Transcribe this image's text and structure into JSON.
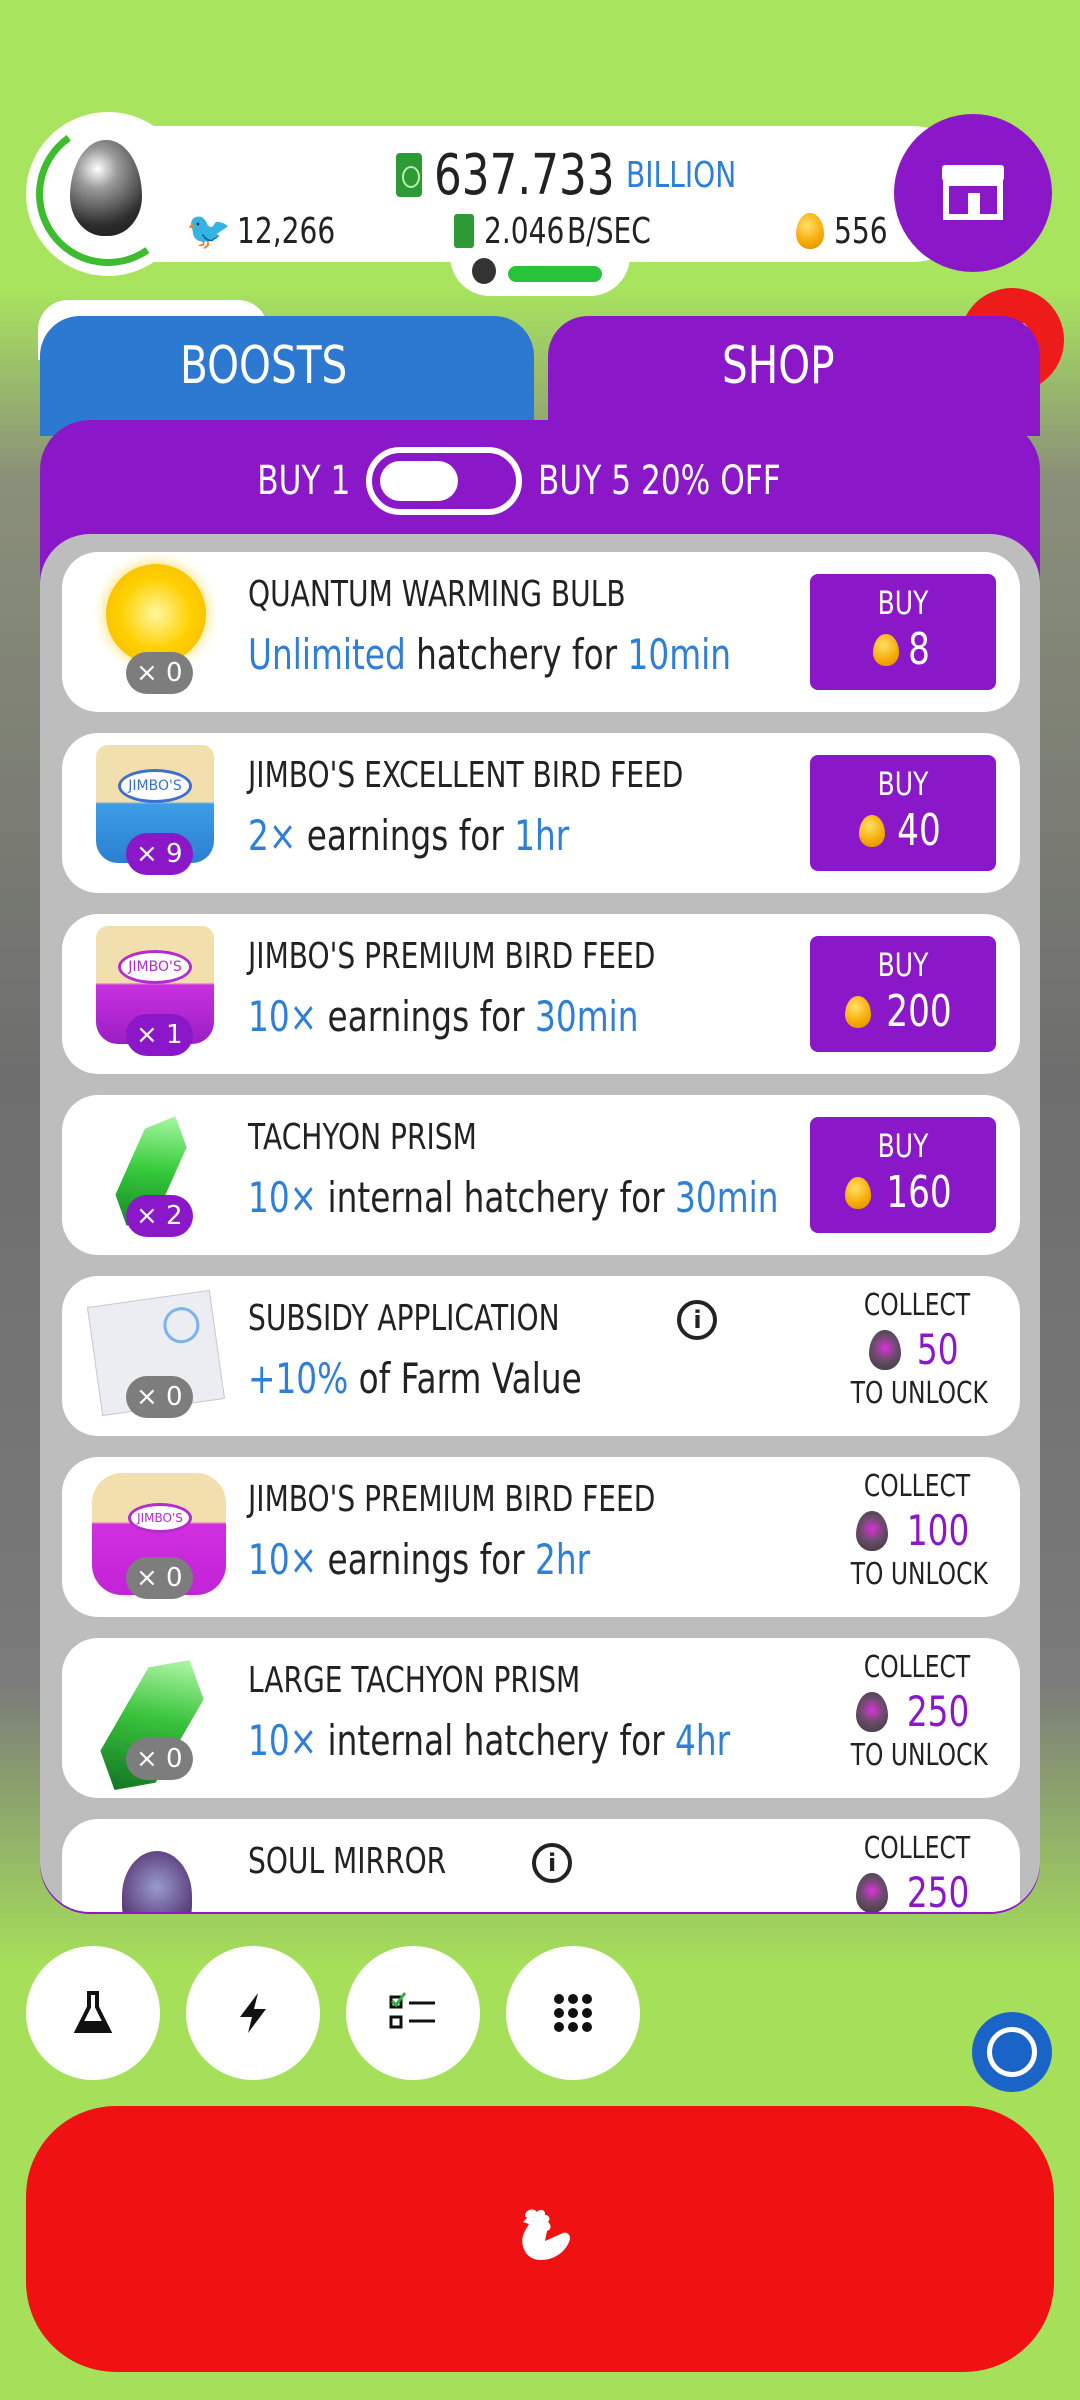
{
  "header": {
    "money_value": "637.733",
    "money_unit": "BILLION",
    "chickens": "12,266",
    "rate_value": "2.046",
    "rate_unit": "B/SEC",
    "golden_eggs": "556"
  },
  "tabs": [
    {
      "label": "BOOSTS"
    },
    {
      "label": "SHOP"
    }
  ],
  "toggle": {
    "left_label": "BUY 1",
    "right_label": "BUY 5 20% OFF"
  },
  "items": [
    {
      "name": "QUANTUM WARMING BULB",
      "desc_a": "Unlimited",
      "desc_b": " hatchery for ",
      "desc_c": "10min",
      "count": "× 0",
      "action": "BUY",
      "price": "8"
    },
    {
      "name": "JIMBO'S EXCELLENT BIRD FEED",
      "desc_a": "2×",
      "desc_b": " earnings for ",
      "desc_c": "1hr",
      "count": "× 9",
      "action": "BUY",
      "price": "40",
      "logo": "JIMBO'S"
    },
    {
      "name": "JIMBO'S PREMIUM BIRD FEED",
      "desc_a": "10×",
      "desc_b": " earnings for ",
      "desc_c": "30min",
      "count": "× 1",
      "action": "BUY",
      "price": "200",
      "logo": "JIMBO'S"
    },
    {
      "name": "TACHYON PRISM",
      "desc_a": "10×",
      "desc_b": " internal hatchery for ",
      "desc_c": "30min",
      "count": "× 2",
      "action": "BUY",
      "price": "160"
    },
    {
      "name": "SUBSIDY APPLICATION",
      "desc_a": "+10%",
      "desc_b": " of Farm Value",
      "desc_c": "",
      "count": "× 0",
      "collect": "COLLECT",
      "unlock_value": "50",
      "unlock_suffix": "TO UNLOCK"
    },
    {
      "name": "JIMBO'S PREMIUM BIRD FEED",
      "desc_a": "10×",
      "desc_b": " earnings for ",
      "desc_c": "2hr",
      "count": "× 0",
      "collect": "COLLECT",
      "unlock_value": "100",
      "unlock_suffix": "TO UNLOCK",
      "logo": "JIMBO'S"
    },
    {
      "name": "LARGE TACHYON PRISM",
      "desc_a": "10×",
      "desc_b": " internal hatchery for ",
      "desc_c": "4hr",
      "count": "× 0",
      "collect": "COLLECT",
      "unlock_value": "250",
      "unlock_suffix": "TO UNLOCK"
    },
    {
      "name": "SOUL MIRROR",
      "collect": "COLLECT",
      "unlock_value": "250"
    }
  ],
  "icons": {
    "close": "✕",
    "research": "flask-icon",
    "boost": "lightning-icon",
    "missions": "checklist-icon",
    "menu": "grid-icon",
    "hatch": "chicken-icon"
  },
  "colors": {
    "primary_purple": "#8a18c8",
    "boosts_blue": "#2d78d0",
    "hatch_red": "#f01212",
    "close_red": "#ee1b1b",
    "accent_blue": "#2d7fd8"
  }
}
